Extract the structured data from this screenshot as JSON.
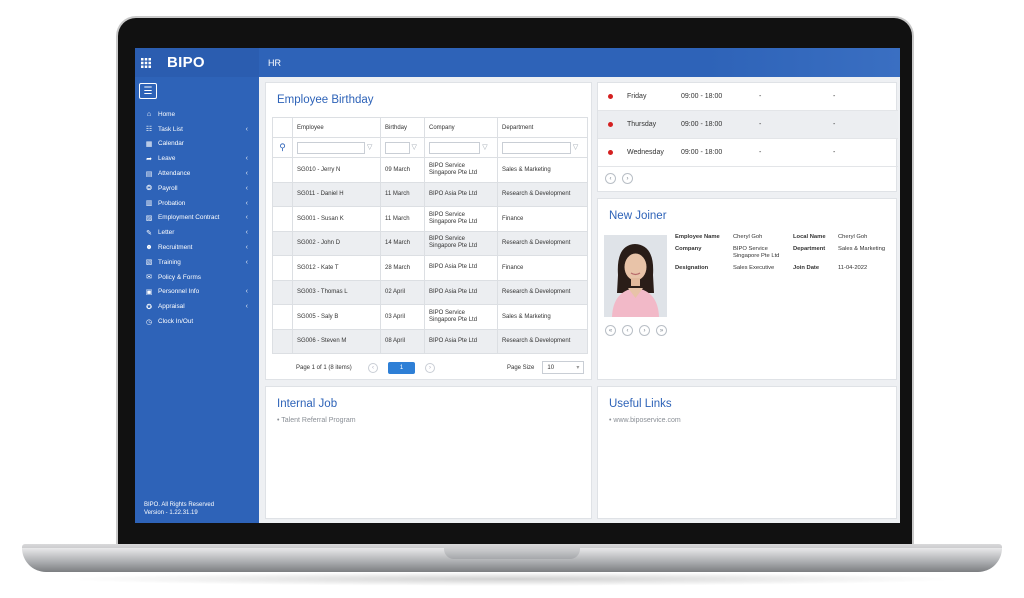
{
  "brand": {
    "name": "BIPO",
    "grid_icon": "app-grid-icon"
  },
  "topbar": {
    "title": "HR"
  },
  "sidebar": {
    "items": [
      {
        "label": "Home",
        "icon": "home-icon",
        "has_children": false
      },
      {
        "label": "Task List",
        "icon": "task-list-icon",
        "has_children": true
      },
      {
        "label": "Calendar",
        "icon": "calendar-icon",
        "has_children": false
      },
      {
        "label": "Leave",
        "icon": "leave-icon",
        "has_children": true
      },
      {
        "label": "Attendance",
        "icon": "attendance-icon",
        "has_children": true
      },
      {
        "label": "Payroll",
        "icon": "payroll-icon",
        "has_children": true
      },
      {
        "label": "Probation",
        "icon": "probation-icon",
        "has_children": true
      },
      {
        "label": "Employment Contract",
        "icon": "contract-icon",
        "has_children": true
      },
      {
        "label": "Letter",
        "icon": "letter-icon",
        "has_children": true
      },
      {
        "label": "Recruitment",
        "icon": "recruitment-icon",
        "has_children": true
      },
      {
        "label": "Training",
        "icon": "training-icon",
        "has_children": true
      },
      {
        "label": "Policy & Forms",
        "icon": "policy-icon",
        "has_children": false
      },
      {
        "label": "Personnel Info",
        "icon": "personnel-icon",
        "has_children": true
      },
      {
        "label": "Appraisal",
        "icon": "appraisal-icon",
        "has_children": true
      },
      {
        "label": "Clock In/Out",
        "icon": "clock-icon",
        "has_children": false
      }
    ],
    "footer_line1": "BIPO. All Rights Reserved",
    "footer_line2": "Version - 1.22.31.19"
  },
  "birthday": {
    "title": "Employee Birthday",
    "columns": [
      "Employee",
      "Birthday",
      "Company",
      "Department"
    ],
    "rows": [
      {
        "employee": "SG010 - Jerry N",
        "birthday": "09 March",
        "company": "BIPO Service Singapore Pte Ltd",
        "department": "Sales & Marketing"
      },
      {
        "employee": "SG011 - Daniel H",
        "birthday": "11 March",
        "company": "BIPO Asia Pte Ltd",
        "department": "Research & Development"
      },
      {
        "employee": "SG001 - Susan K",
        "birthday": "11 March",
        "company": "BIPO Service Singapore Pte Ltd",
        "department": "Finance"
      },
      {
        "employee": "SG002 - John D",
        "birthday": "14 March",
        "company": "BIPO Service Singapore Pte Ltd",
        "department": "Research & Development"
      },
      {
        "employee": "SG012 - Kate T",
        "birthday": "28 March",
        "company": "BIPO Asia Pte Ltd",
        "department": "Finance"
      },
      {
        "employee": "SG003 - Thomas L",
        "birthday": "02 April",
        "company": "BIPO Asia Pte Ltd",
        "department": "Research & Development"
      },
      {
        "employee": "SG005 - Saly B",
        "birthday": "03 April",
        "company": "BIPO Service Singapore Pte Ltd",
        "department": "Sales & Marketing"
      },
      {
        "employee": "SG006 - Steven M",
        "birthday": "08 April",
        "company": "BIPO Asia Pte Ltd",
        "department": "Research & Development"
      }
    ],
    "pager_text": "Page 1 of 1 (8 items)",
    "current_page": "1",
    "page_size_label": "Page Size",
    "page_size_value": "10"
  },
  "schedule": {
    "rows": [
      {
        "day": "Friday",
        "time": "09:00 - 18:00",
        "c3": "-",
        "c4": "-"
      },
      {
        "day": "Thursday",
        "time": "09:00 - 18:00",
        "c3": "-",
        "c4": "-"
      },
      {
        "day": "Wednesday",
        "time": "09:00 - 18:00",
        "c3": "-",
        "c4": "-"
      }
    ],
    "status_color": "#d42020"
  },
  "new_joiner": {
    "title": "New Joiner",
    "employee_name_label": "Employee Name",
    "employee_name": "Cheryl Goh",
    "local_name_label": "Local Name",
    "local_name": "Cheryl Goh",
    "company_label": "Company",
    "company": "BIPO Service Singapore Pte Ltd",
    "department_label": "Department",
    "department": "Sales & Marketing",
    "designation_label": "Designation",
    "designation": "Sales Executive",
    "join_date_label": "Join Date",
    "join_date": "11-04-2022"
  },
  "internal_job": {
    "title": "Internal Job",
    "items": [
      "• Talent Referral Program"
    ]
  },
  "useful_links": {
    "title": "Useful Links",
    "items": [
      "• www.biposervice.com"
    ]
  },
  "colors": {
    "accent": "#2e63b8",
    "button": "#2e7fd6"
  }
}
